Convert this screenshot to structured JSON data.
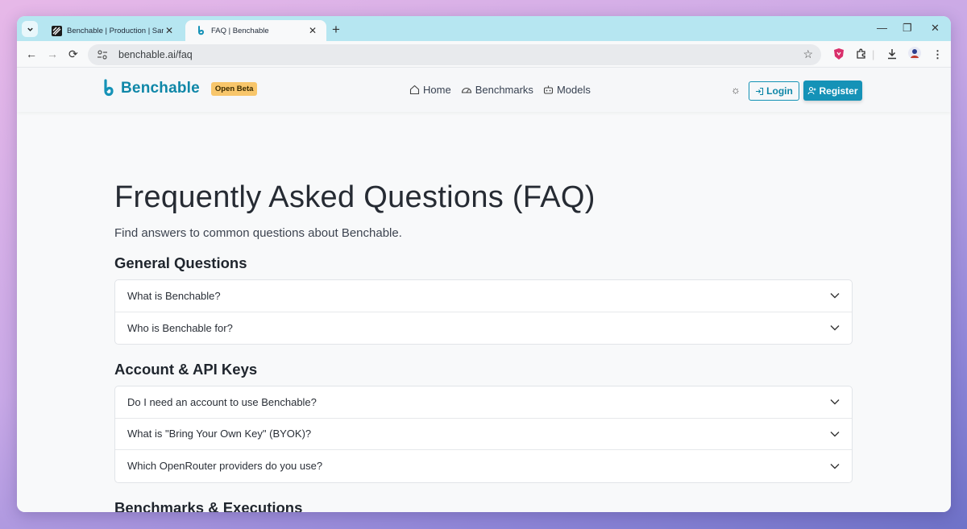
{
  "browser": {
    "tabs": [
      {
        "title": "Benchable | Production | Sanity",
        "active": false
      },
      {
        "title": "FAQ | Benchable",
        "active": true
      }
    ],
    "url": "benchable.ai/faq"
  },
  "navbar": {
    "brand": "Benchable",
    "badge": "Open Beta",
    "links": [
      {
        "label": "Home",
        "icon": "home-icon"
      },
      {
        "label": "Benchmarks",
        "icon": "gauge-icon"
      },
      {
        "label": "Models",
        "icon": "robot-icon"
      }
    ],
    "login_label": "Login",
    "register_label": "Register"
  },
  "main": {
    "title": "Frequently Asked Questions (FAQ)",
    "subtitle": "Find answers to common questions about Benchable.",
    "sections": [
      {
        "title": "General Questions",
        "questions": [
          "What is Benchable?",
          "Who is Benchable for?"
        ]
      },
      {
        "title": "Account & API Keys",
        "questions": [
          "Do I need an account to use Benchable?",
          "What is \"Bring Your Own Key\" (BYOK)?",
          "Which OpenRouter providers do you use?"
        ]
      },
      {
        "title": "Benchmarks & Executions",
        "questions": []
      }
    ]
  },
  "colors": {
    "brand": "#0f87a8",
    "badge": "#f8c66b",
    "register_bg": "#1592b7",
    "tabstrip": "#b6e6f1"
  }
}
